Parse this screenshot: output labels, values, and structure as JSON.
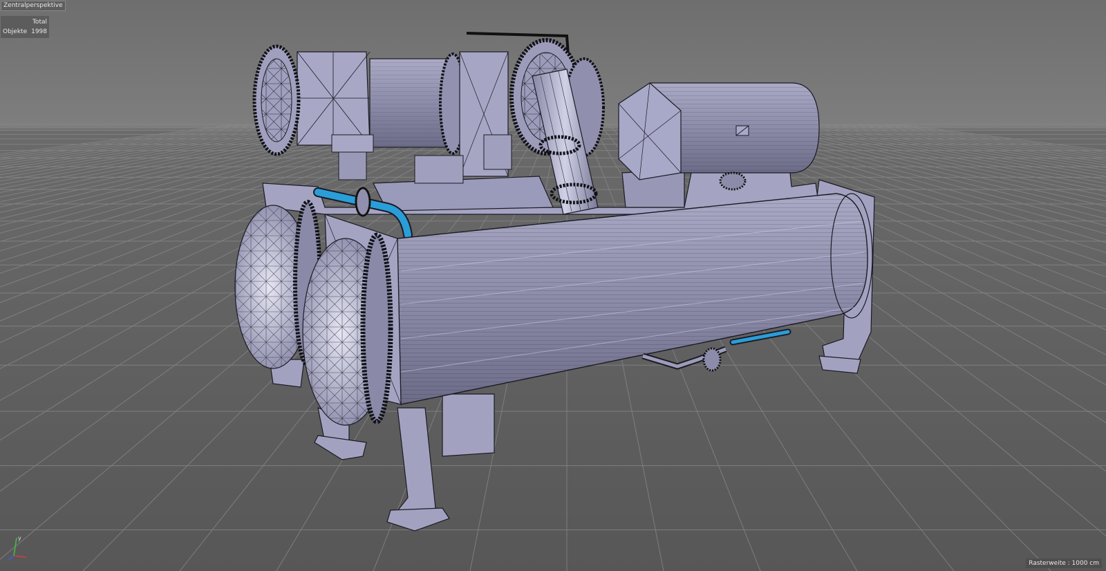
{
  "viewport": {
    "camera_label": "Zentralperspektive",
    "stats": {
      "header": "Total",
      "objects_label": "Objekte",
      "objects_value": "1998"
    },
    "grid_info": "Rasterweite : 1000 cm"
  },
  "axis_gizmo": {
    "x_label": "",
    "y_label": "y",
    "z_label": "",
    "x_color": "#d04040",
    "y_color": "#40c040",
    "z_color": "#4060e0"
  },
  "scene": {
    "floor_grid_color": "#8a8a8a",
    "wire_color": "#1a1a24",
    "surface_color": "#9a9ab8",
    "highlight_color": "#d8d8ee",
    "pipe_accent_color": "#2a9ed8",
    "icons": [
      "axis-gizmo-icon",
      "chiller-model-icon"
    ]
  }
}
